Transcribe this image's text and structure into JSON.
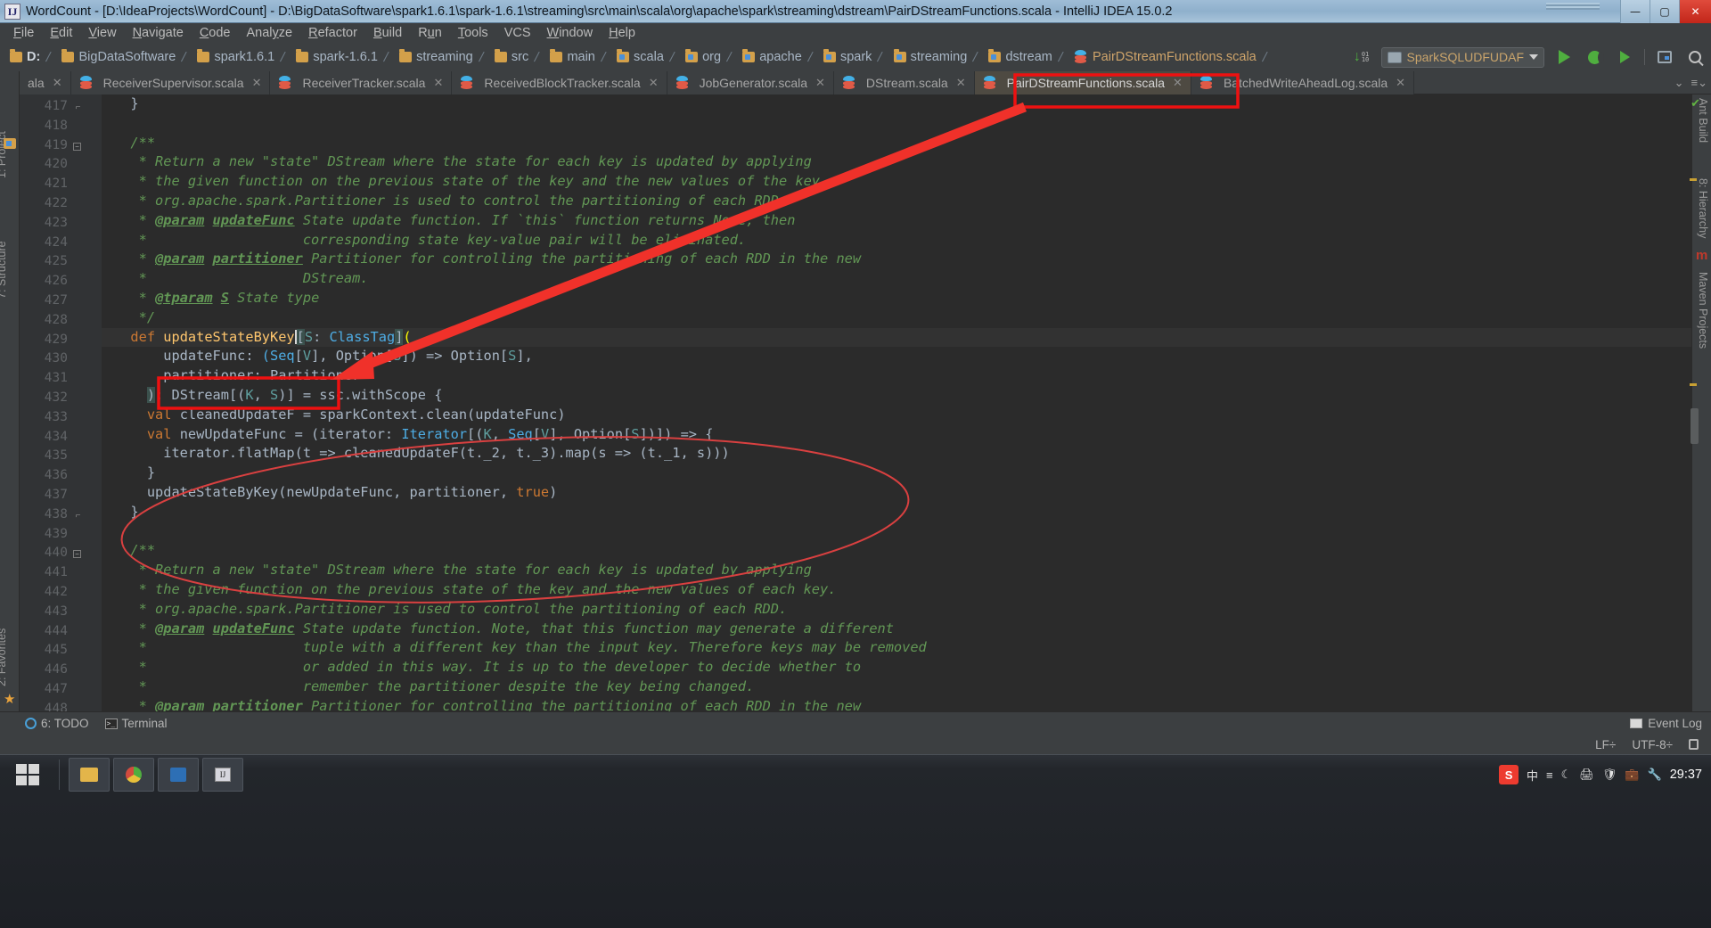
{
  "window": {
    "title": "WordCount - [D:\\IdeaProjects\\WordCount] - D:\\BigDataSoftware\\spark1.6.1\\spark-1.6.1\\streaming\\src\\main\\scala\\org\\apache\\spark\\streaming\\dstream\\PairDStreamFunctions.scala - IntelliJ IDEA 15.0.2",
    "app_icon": "IJ",
    "minimize": "—",
    "maximize": "▢",
    "close": "✕"
  },
  "menu": {
    "items": [
      "File",
      "Edit",
      "View",
      "Navigate",
      "Code",
      "Analyze",
      "Refactor",
      "Build",
      "Run",
      "Tools",
      "VCS",
      "Window",
      "Help"
    ]
  },
  "navbar": {
    "crumbs": [
      {
        "label": "D:",
        "icon": "folder-icon"
      },
      {
        "label": "BigDataSoftware",
        "icon": "folder-icon"
      },
      {
        "label": "spark1.6.1",
        "icon": "folder-icon"
      },
      {
        "label": "spark-1.6.1",
        "icon": "folder-icon"
      },
      {
        "label": "streaming",
        "icon": "folder-icon"
      },
      {
        "label": "src",
        "icon": "folder-icon"
      },
      {
        "label": "main",
        "icon": "folder-icon"
      },
      {
        "label": "scala",
        "icon": "source-folder-icon"
      },
      {
        "label": "org",
        "icon": "source-folder-icon"
      },
      {
        "label": "apache",
        "icon": "source-folder-icon"
      },
      {
        "label": "spark",
        "icon": "source-folder-icon"
      },
      {
        "label": "streaming",
        "icon": "source-folder-icon"
      },
      {
        "label": "dstream",
        "icon": "source-folder-icon"
      },
      {
        "label": "PairDStreamFunctions.scala",
        "icon": "scala-file-icon"
      }
    ],
    "run_config": "SparkSQLUDFUDAF",
    "tools": [
      "update-project-icon",
      "run-button",
      "debug-button",
      "coverage-button",
      "build-layout-button",
      "search-everywhere-button"
    ]
  },
  "tabs": {
    "partial_left_label": "ala",
    "items": [
      {
        "label": "ReceiverSupervisor.scala",
        "active": false,
        "closeable": true
      },
      {
        "label": "ReceiverTracker.scala",
        "active": false,
        "closeable": true
      },
      {
        "label": "ReceivedBlockTracker.scala",
        "active": false,
        "closeable": true
      },
      {
        "label": "JobGenerator.scala",
        "active": false,
        "closeable": true
      },
      {
        "label": "DStream.scala",
        "active": false,
        "closeable": true
      },
      {
        "label": "PairDStreamFunctions.scala",
        "active": true,
        "closeable": true,
        "highlighted": true
      },
      {
        "label": "BatchedWriteAheadLog.scala",
        "active": false,
        "closeable": true
      }
    ]
  },
  "sidebars": {
    "left": [
      {
        "label": "1: Project"
      },
      {
        "label": "7: Structure"
      },
      {
        "label": "2: Favorites"
      }
    ],
    "right": [
      {
        "label": "Ant Build"
      },
      {
        "label": "8: Hierarchy"
      },
      {
        "label": "Maven Projects"
      }
    ]
  },
  "editor": {
    "first_line": 417,
    "lines": [
      {
        "n": 417,
        "fold": "end",
        "segs": [
          {
            "t": "  }",
            "c": "punct"
          }
        ]
      },
      {
        "n": 418,
        "segs": []
      },
      {
        "n": 419,
        "fold": "start",
        "segs": [
          {
            "t": "  /**",
            "c": "cmt"
          }
        ]
      },
      {
        "n": 420,
        "segs": [
          {
            "t": "   * Return a new \"state\" DStream where the state for each key is updated by applying",
            "c": "cmt"
          }
        ]
      },
      {
        "n": 421,
        "segs": [
          {
            "t": "   * the given function on the previous state of the key and the new values of the key.",
            "c": "cmt"
          }
        ]
      },
      {
        "n": 422,
        "segs": [
          {
            "t": "   * org.apache.spark.Partitioner is used to control the partitioning of each RDD.",
            "c": "cmt"
          }
        ]
      },
      {
        "n": 423,
        "segs": [
          {
            "t": "   * ",
            "c": "cmt"
          },
          {
            "t": "@param",
            "c": "cmtt"
          },
          {
            "t": " ",
            "c": "cmt"
          },
          {
            "t": "updateFunc",
            "c": "cmtt"
          },
          {
            "t": " State update function. If `this` function returns None, then",
            "c": "cmt"
          }
        ]
      },
      {
        "n": 424,
        "segs": [
          {
            "t": "   *                   corresponding state key-value pair will be eliminated.",
            "c": "cmt"
          }
        ]
      },
      {
        "n": 425,
        "segs": [
          {
            "t": "   * ",
            "c": "cmt"
          },
          {
            "t": "@param",
            "c": "cmtt"
          },
          {
            "t": " ",
            "c": "cmt"
          },
          {
            "t": "partitioner",
            "c": "cmtt"
          },
          {
            "t": " Partitioner for controlling the partitioning of each RDD in the new",
            "c": "cmt"
          }
        ]
      },
      {
        "n": 426,
        "segs": [
          {
            "t": "   *                   DStream.",
            "c": "cmt"
          }
        ]
      },
      {
        "n": 427,
        "segs": [
          {
            "t": "   * ",
            "c": "cmt"
          },
          {
            "t": "@tparam",
            "c": "cmtt"
          },
          {
            "t": " ",
            "c": "cmt"
          },
          {
            "t": "S",
            "c": "cmtt"
          },
          {
            "t": " State type",
            "c": "cmt"
          }
        ]
      },
      {
        "n": 428,
        "segs": [
          {
            "t": "   */",
            "c": "cmt"
          }
        ]
      },
      {
        "n": 429,
        "caret": true,
        "segs": [
          {
            "t": "  ",
            "c": "punct"
          },
          {
            "t": "def",
            "c": "kw"
          },
          {
            "t": " ",
            "c": "punct"
          },
          {
            "t": "updateStateByKey",
            "c": "fn",
            "boxed": true
          },
          {
            "t": "[",
            "c": "hl-brace"
          },
          {
            "t": "S",
            "c": "gen2"
          },
          {
            "t": ": ",
            "c": "punct"
          },
          {
            "t": "ClassTag",
            "c": "gen"
          },
          {
            "t": "]",
            "c": "hl-brace"
          },
          {
            "t": "(",
            "c": "hl-paren"
          }
        ]
      },
      {
        "n": 430,
        "segs": [
          {
            "t": "      updateFunc: ",
            "c": "punct"
          },
          {
            "t": "(",
            "c": "gen"
          },
          {
            "t": "Seq",
            "c": "gen"
          },
          {
            "t": "[",
            "c": "punct"
          },
          {
            "t": "V",
            "c": "gen2"
          },
          {
            "t": "], Option[",
            "c": "punct"
          },
          {
            "t": "S",
            "c": "gen2"
          },
          {
            "t": "]) => Option[",
            "c": "punct"
          },
          {
            "t": "S",
            "c": "gen2"
          },
          {
            "t": "],",
            "c": "punct"
          }
        ]
      },
      {
        "n": 431,
        "segs": [
          {
            "t": "      partitioner: Partitioner",
            "c": "punct"
          }
        ]
      },
      {
        "n": 432,
        "segs": [
          {
            "t": "    ",
            "c": "punct"
          },
          {
            "t": ")",
            "c": "hl-brace"
          },
          {
            "t": ": DStream[(",
            "c": "punct"
          },
          {
            "t": "K",
            "c": "gen2"
          },
          {
            "t": ", ",
            "c": "punct"
          },
          {
            "t": "S",
            "c": "gen2"
          },
          {
            "t": ")] = ssc.withScope {",
            "c": "punct"
          }
        ]
      },
      {
        "n": 433,
        "segs": [
          {
            "t": "    ",
            "c": "punct"
          },
          {
            "t": "val",
            "c": "kw"
          },
          {
            "t": " cleanedUpdateF = sparkContext.clean(updateFunc)",
            "c": "punct"
          }
        ]
      },
      {
        "n": 434,
        "segs": [
          {
            "t": "    ",
            "c": "punct"
          },
          {
            "t": "val",
            "c": "kw"
          },
          {
            "t": " newUpdateFunc = (iterator: ",
            "c": "punct"
          },
          {
            "t": "Iterator",
            "c": "gen"
          },
          {
            "t": "[(",
            "c": "punct"
          },
          {
            "t": "K",
            "c": "gen2"
          },
          {
            "t": ", ",
            "c": "punct"
          },
          {
            "t": "Seq",
            "c": "gen"
          },
          {
            "t": "[",
            "c": "punct"
          },
          {
            "t": "V",
            "c": "gen2"
          },
          {
            "t": "], Option[",
            "c": "punct"
          },
          {
            "t": "S",
            "c": "gen2"
          },
          {
            "t": "])]) => {",
            "c": "punct"
          }
        ]
      },
      {
        "n": 435,
        "segs": [
          {
            "t": "      iterator.flatMap(t => cleanedUpdateF(t._2, t._3).map(s => (t._1, s)))",
            "c": "punct"
          }
        ]
      },
      {
        "n": 436,
        "segs": [
          {
            "t": "    }",
            "c": "punct"
          }
        ]
      },
      {
        "n": 437,
        "segs": [
          {
            "t": "    updateStateByKey(newUpdateFunc, partitioner, ",
            "c": "punct"
          },
          {
            "t": "true",
            "c": "kw"
          },
          {
            "t": ")",
            "c": "punct"
          }
        ]
      },
      {
        "n": 438,
        "fold": "end",
        "segs": [
          {
            "t": "  }",
            "c": "punct"
          }
        ]
      },
      {
        "n": 439,
        "segs": []
      },
      {
        "n": 440,
        "fold": "start",
        "segs": [
          {
            "t": "  /**",
            "c": "cmt"
          }
        ]
      },
      {
        "n": 441,
        "segs": [
          {
            "t": "   * Return a new \"state\" DStream where the state for each key is updated by applying",
            "c": "cmt"
          }
        ]
      },
      {
        "n": 442,
        "segs": [
          {
            "t": "   * the given function on the previous state of the key and the new values of each key.",
            "c": "cmt"
          }
        ]
      },
      {
        "n": 443,
        "segs": [
          {
            "t": "   * org.apache.spark.Partitioner is used to control the partitioning of each RDD.",
            "c": "cmt"
          }
        ]
      },
      {
        "n": 444,
        "segs": [
          {
            "t": "   * ",
            "c": "cmt"
          },
          {
            "t": "@param",
            "c": "cmtt"
          },
          {
            "t": " ",
            "c": "cmt"
          },
          {
            "t": "updateFunc",
            "c": "cmtt"
          },
          {
            "t": " State update function. Note, that this function may generate a different",
            "c": "cmt"
          }
        ]
      },
      {
        "n": 445,
        "segs": [
          {
            "t": "   *                   tuple with a different key than the input key. Therefore keys may be removed",
            "c": "cmt"
          }
        ]
      },
      {
        "n": 446,
        "segs": [
          {
            "t": "   *                   or added in this way. It is up to the developer to decide whether to",
            "c": "cmt"
          }
        ]
      },
      {
        "n": 447,
        "segs": [
          {
            "t": "   *                   remember the partitioner despite the key being changed.",
            "c": "cmt"
          }
        ]
      },
      {
        "n": 448,
        "segs": [
          {
            "t": "   * ",
            "c": "cmt"
          },
          {
            "t": "@param",
            "c": "cmtt"
          },
          {
            "t": " ",
            "c": "cmt"
          },
          {
            "t": "partitioner",
            "c": "cmtt"
          },
          {
            "t": " Partitioner for controlling the partitioning of each RDD in the new",
            "c": "cmt"
          }
        ]
      }
    ]
  },
  "annotations": {
    "arrow": {
      "from": "PairDStreamFunctions.scala tab",
      "to": "updateStateByKey method name",
      "color": "#ee1111"
    },
    "tab_box_color": "#ee1111",
    "method_box_color": "#ee1111",
    "ellipse_color": "#d94040"
  },
  "bottom_toolwindows": [
    {
      "label": "6: TODO",
      "icon": "todo-icon"
    },
    {
      "label": "Terminal",
      "icon": "terminal-icon"
    }
  ],
  "event_log": {
    "label": "Event Log",
    "icon": "event-log-icon"
  },
  "ide_status": {
    "line_ending": "LF÷",
    "encoding": "UTF-8÷",
    "lock": "lock-icon"
  },
  "taskbar": {
    "start_label": "start",
    "clock": "29:37",
    "ime_lang": "中",
    "tray_icons": [
      "sogou-icon",
      "ime-cn-icon",
      "keyboard-icon",
      "moon-icon",
      "printer-icon",
      "shield-icon",
      "bag-icon",
      "wrench-icon"
    ],
    "task_buttons": [
      "explorer",
      "browser",
      "media",
      "idea"
    ]
  }
}
